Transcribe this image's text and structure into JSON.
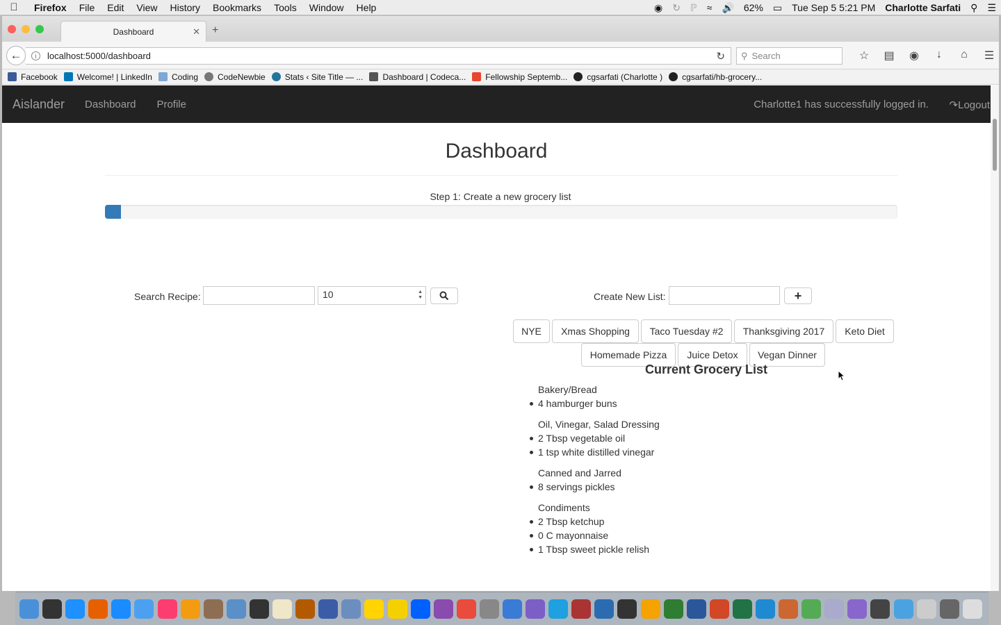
{
  "menubar": {
    "app": "Firefox",
    "items": [
      "File",
      "Edit",
      "View",
      "History",
      "Bookmarks",
      "Tools",
      "Window",
      "Help"
    ],
    "battery": "62%",
    "clock": "Tue Sep 5  5:21 PM",
    "user": "Charlotte Sarfati"
  },
  "browser": {
    "tab_title": "Dashboard",
    "url": "localhost:5000/dashboard",
    "search_placeholder": "Search",
    "bookmarks": [
      {
        "label": "Facebook",
        "color": "#3b5998"
      },
      {
        "label": "Welcome! | LinkedIn",
        "color": "#0077b5"
      },
      {
        "label": "Coding",
        "color": "#7fa7d6"
      },
      {
        "label": "CodeNewbie",
        "color": "#777777"
      },
      {
        "label": "Stats ‹ Site Title — ...",
        "color": "#21759b"
      },
      {
        "label": "Dashboard | Codeca...",
        "color": "#555555"
      },
      {
        "label": "Fellowship Septemb...",
        "color": "#e8452c"
      },
      {
        "label": "cgsarfati (Charlotte )",
        "color": "#222222"
      },
      {
        "label": "cgsarfati/hb-grocery...",
        "color": "#222222"
      }
    ]
  },
  "site": {
    "brand": "Aislander",
    "nav": [
      "Dashboard",
      "Profile"
    ],
    "login_message": "Charlotte1 has successfully logged in.",
    "logout_label": "Logout"
  },
  "main": {
    "title": "Dashboard",
    "step_text": "Step 1: Create a new grocery list",
    "progress_fraction": 0.02,
    "search_label": "Search Recipe:",
    "search_value": "",
    "count_value": "10",
    "create_label": "Create New List:",
    "create_value": "",
    "lists": [
      "NYE",
      "Xmas Shopping",
      "Taco Tuesday #2",
      "Thanksgiving 2017",
      "Keto Diet",
      "Homemade Pizza",
      "Juice Detox",
      "Vegan Dinner"
    ]
  },
  "grocery": {
    "title": "Current Grocery List",
    "categories": [
      {
        "name": "Bakery/Bread",
        "items": [
          "4 hamburger buns"
        ]
      },
      {
        "name": "Oil, Vinegar, Salad Dressing",
        "items": [
          "2 Tbsp vegetable oil",
          "1 tsp white distilled vinegar"
        ]
      },
      {
        "name": "Canned and Jarred",
        "items": [
          "8 servings pickles"
        ]
      },
      {
        "name": "Condiments",
        "items": [
          "2 Tbsp ketchup",
          "0 C mayonnaise",
          "1 Tbsp sweet pickle relish"
        ]
      }
    ]
  },
  "dock": {
    "colors": [
      "#4a90d9",
      "#333333",
      "#1e90ff",
      "#e66000",
      "#1a8cff",
      "#4ca0f0",
      "#fc3d6f",
      "#f39c12",
      "#8e6e53",
      "#5b8fc7",
      "#333",
      "#f0e6c8",
      "#b35a00",
      "#3b5da8",
      "#6c8ebf",
      "#ffd400",
      "#f5d000",
      "#0061fe",
      "#8a4baf",
      "#e94b3c",
      "#888",
      "#3a7bd5",
      "#7b5fc7",
      "#1fa0e0",
      "#a33",
      "#2b6cb0",
      "#333",
      "#f4a300",
      "#2e7d32",
      "#2b579a",
      "#d24726",
      "#217346",
      "#1f8ad1",
      "#c63",
      "#5a5",
      "#aac",
      "#8866cc",
      "#444",
      "#4aa3e0",
      "#ccc",
      "#666",
      "#ddd"
    ]
  }
}
